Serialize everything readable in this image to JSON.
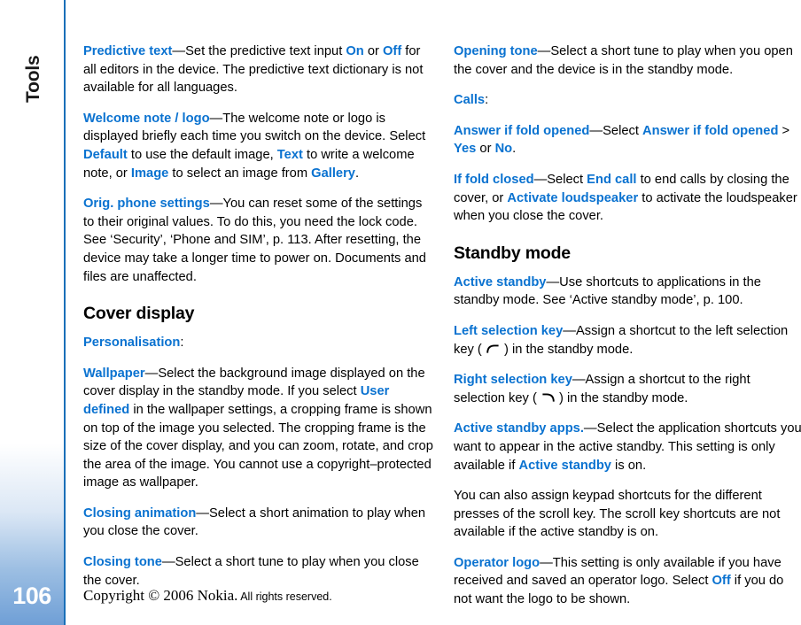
{
  "chapter": {
    "title": "Tools",
    "page_number": "106"
  },
  "footer": {
    "copyright_serif": "Copyright © 2006 Nokia.",
    "copyright_sans": "All rights reserved."
  },
  "left_column": {
    "blocks": [
      {
        "type": "paragraph",
        "name": "para-predictive-text",
        "runs": [
          {
            "t": "Predictive text",
            "k": true
          },
          {
            "t": "—Set the predictive text input "
          },
          {
            "t": "On",
            "k": true
          },
          {
            "t": " or "
          },
          {
            "t": "Off",
            "k": true
          },
          {
            "t": " for all editors in the device. The predictive text dictionary is not available for all languages."
          }
        ]
      },
      {
        "type": "paragraph",
        "name": "para-welcome-note-logo",
        "runs": [
          {
            "t": "Welcome note / logo",
            "k": true
          },
          {
            "t": "—The welcome note or logo is displayed briefly each time you switch on the device. Select "
          },
          {
            "t": "Default",
            "k": true
          },
          {
            "t": " to use the default image, "
          },
          {
            "t": "Text",
            "k": true
          },
          {
            "t": " to write a welcome note, or "
          },
          {
            "t": "Image",
            "k": true
          },
          {
            "t": " to select an image from "
          },
          {
            "t": "Gallery",
            "k": true
          },
          {
            "t": "."
          }
        ]
      },
      {
        "type": "paragraph",
        "name": "para-orig-phone-settings",
        "runs": [
          {
            "t": "Orig. phone settings",
            "k": true
          },
          {
            "t": "—You can reset some of the settings to their original values. To do this, you need the lock code. See ‘Security’, ‘Phone and SIM’, p. 113. After resetting, the device may take a longer time to power on. Documents and files are unaffected."
          }
        ]
      },
      {
        "type": "heading",
        "name": "heading-cover-display",
        "text": "Cover display"
      },
      {
        "type": "paragraph",
        "name": "para-personalisation",
        "runs": [
          {
            "t": "Personalisation",
            "k": true
          },
          {
            "t": ":"
          }
        ]
      },
      {
        "type": "paragraph",
        "name": "para-wallpaper",
        "runs": [
          {
            "t": "Wallpaper",
            "k": true
          },
          {
            "t": "—Select the background image displayed on the cover display in the standby mode. If you select "
          },
          {
            "t": "User defined",
            "k": true
          },
          {
            "t": " in the wallpaper settings, a cropping frame is shown on top of the image you selected. The cropping frame is the size of the cover display, and you can zoom, rotate, and crop the area of the image. You cannot use a copyright–protected image as wallpaper."
          }
        ]
      },
      {
        "type": "paragraph",
        "name": "para-closing-animation",
        "runs": [
          {
            "t": "Closing animation",
            "k": true
          },
          {
            "t": "—Select a short animation to play when you close the cover."
          }
        ]
      },
      {
        "type": "paragraph",
        "name": "para-closing-tone",
        "runs": [
          {
            "t": "Closing tone",
            "k": true
          },
          {
            "t": "—Select a short tune to play when you close the cover."
          }
        ]
      }
    ]
  },
  "right_column": {
    "blocks": [
      {
        "type": "paragraph",
        "name": "para-opening-tone",
        "runs": [
          {
            "t": "Opening tone",
            "k": true
          },
          {
            "t": "—Select a short tune to play when you open the cover and the device is in the standby mode."
          }
        ]
      },
      {
        "type": "paragraph",
        "name": "para-calls",
        "runs": [
          {
            "t": "Calls",
            "k": true
          },
          {
            "t": ":"
          }
        ]
      },
      {
        "type": "paragraph",
        "name": "para-answer-if-fold-opened",
        "runs": [
          {
            "t": "Answer if fold opened",
            "k": true
          },
          {
            "t": "—Select "
          },
          {
            "t": "Answer if fold opened",
            "k": true
          },
          {
            "t": " > "
          },
          {
            "t": "Yes",
            "k": true
          },
          {
            "t": " or "
          },
          {
            "t": "No",
            "k": true
          },
          {
            "t": "."
          }
        ]
      },
      {
        "type": "paragraph",
        "name": "para-if-fold-closed",
        "runs": [
          {
            "t": "If fold closed",
            "k": true
          },
          {
            "t": "—Select "
          },
          {
            "t": "End call",
            "k": true
          },
          {
            "t": " to end calls by closing the cover, or "
          },
          {
            "t": "Activate loudspeaker",
            "k": true
          },
          {
            "t": " to activate the loudspeaker when you close the cover."
          }
        ]
      },
      {
        "type": "heading",
        "name": "heading-standby-mode",
        "text": "Standby mode"
      },
      {
        "type": "paragraph",
        "name": "para-active-standby",
        "runs": [
          {
            "t": "Active standby",
            "k": true
          },
          {
            "t": "—Use shortcuts to applications in the standby mode. See ‘Active standby mode’, p. 100."
          }
        ]
      },
      {
        "type": "paragraph",
        "name": "para-left-selection-key",
        "runs": [
          {
            "t": "Left selection key",
            "k": true
          },
          {
            "t": "—Assign a shortcut to the left selection key ( "
          },
          {
            "icon": "left-selection-key-icon"
          },
          {
            "t": " ) in the standby mode."
          }
        ]
      },
      {
        "type": "paragraph",
        "name": "para-right-selection-key",
        "runs": [
          {
            "t": "Right selection key",
            "k": true
          },
          {
            "t": "—Assign a shortcut to the right selection key ( "
          },
          {
            "icon": "right-selection-key-icon"
          },
          {
            "t": " ) in the standby mode."
          }
        ]
      },
      {
        "type": "paragraph",
        "name": "para-active-standby-apps",
        "runs": [
          {
            "t": "Active standby apps.",
            "k": true
          },
          {
            "t": "—Select the application shortcuts you want to appear in the active standby. This setting is only available if "
          },
          {
            "t": "Active standby",
            "k": true
          },
          {
            "t": " is on."
          }
        ]
      },
      {
        "type": "paragraph",
        "name": "para-keypad-shortcuts",
        "runs": [
          {
            "t": "You can also assign keypad shortcuts for the different presses of the scroll key. The scroll key shortcuts are not available if the active standby is on."
          }
        ]
      },
      {
        "type": "paragraph",
        "name": "para-operator-logo",
        "runs": [
          {
            "t": "Operator logo",
            "k": true
          },
          {
            "t": "—This setting is only available if you have received and saved an operator logo. Select "
          },
          {
            "t": "Off",
            "k": true
          },
          {
            "t": " if you do not want the logo to be shown."
          }
        ]
      }
    ]
  },
  "colors": {
    "keyword_blue": "#0a72d0",
    "rule_blue": "#1a6fb8",
    "sidebar_bottom_blue": "#6f9fd6"
  }
}
